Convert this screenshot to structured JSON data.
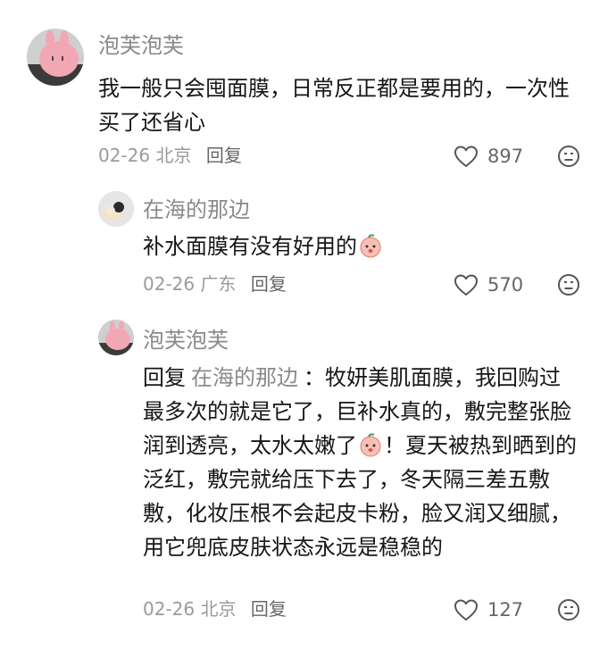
{
  "comments": [
    {
      "user": "泡芙泡芙",
      "text": "我一般只会囤面膜，日常反正都是要用的，一次性买了还省心",
      "date": "02-26",
      "location": "北京",
      "reply_label": "回复",
      "likes": "897"
    },
    {
      "user": "在海的那边",
      "text": "补水面膜有没有好用的",
      "date": "02-26",
      "location": "广东",
      "reply_label": "回复",
      "likes": "570"
    },
    {
      "user": "泡芙泡芙",
      "reply_prefix": "回复",
      "reply_to": "在海的那边",
      "text_a": "：牧妍美肌面膜，我回购过最多次的就是它了，巨补水真的，敷完整张脸润到透亮，太水太嫩了",
      "text_b": "！夏天被热到晒到的泛红，敷完就给压下去了，冬天隔三差五敷敷，化妆压根不会起皮卡粉，脸又润又细腻，用它兜底皮肤状态永远是稳稳的",
      "date": "02-26",
      "location": "北京",
      "reply_label": "回复",
      "likes": "127"
    }
  ],
  "icons": {
    "like": "heart-outline-icon",
    "dislike": "neutral-face-icon",
    "emoji": "peach-face-emoji"
  }
}
